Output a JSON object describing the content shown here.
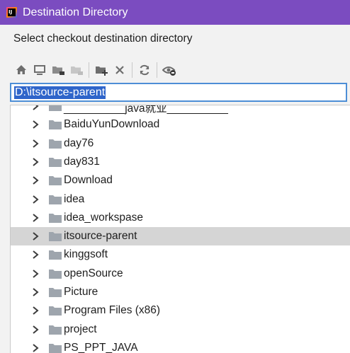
{
  "window": {
    "title": "Destination Directory"
  },
  "prompt": "Select checkout destination directory",
  "toolbar": {
    "buttons": [
      "home-icon",
      "desktop-icon",
      "project-folder-icon",
      "module-folder-icon",
      "new-folder-icon",
      "delete-icon",
      "refresh-icon",
      "show-hidden-icon"
    ]
  },
  "path": {
    "value": "D:\\itsource-parent"
  },
  "tree": {
    "items": [
      {
        "label": "__________java就业__________",
        "selected": false
      },
      {
        "label": "BaiduYunDownload",
        "selected": false
      },
      {
        "label": "day76",
        "selected": false
      },
      {
        "label": "day831",
        "selected": false
      },
      {
        "label": "Download",
        "selected": false
      },
      {
        "label": "idea",
        "selected": false
      },
      {
        "label": "idea_workspase",
        "selected": false
      },
      {
        "label": "itsource-parent",
        "selected": true
      },
      {
        "label": "kinggsoft",
        "selected": false
      },
      {
        "label": "openSource",
        "selected": false
      },
      {
        "label": "Picture",
        "selected": false
      },
      {
        "label": "Program Files (x86)",
        "selected": false
      },
      {
        "label": "project",
        "selected": false
      },
      {
        "label": "PS_PPT_JAVA",
        "selected": false
      }
    ]
  }
}
